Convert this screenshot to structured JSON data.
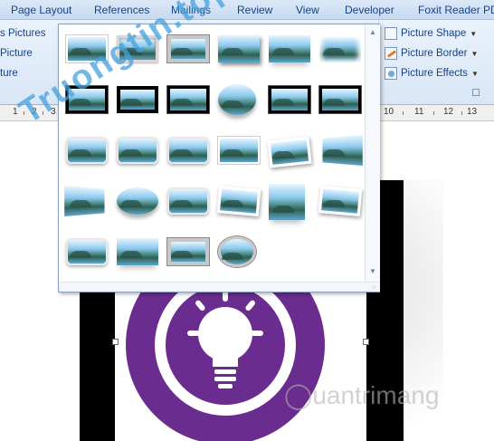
{
  "ribbon_tabs": [
    "Page Layout",
    "References",
    "Mailings",
    "Review",
    "View",
    "Developer",
    "Foxit Reader PDF"
  ],
  "left_group": {
    "item1": "s Pictures",
    "item2": "Picture",
    "item3": "ture"
  },
  "picture_tools": {
    "shape": "Picture Shape",
    "border": "Picture Border",
    "effects": "Picture Effects"
  },
  "ruler": {
    "left_marks": [
      "1",
      "2",
      "3"
    ],
    "right_marks": [
      "10",
      "11",
      "12",
      "13"
    ]
  },
  "gallery": {
    "styles": [
      "simple-frame-white",
      "beveled-matte-white",
      "metal-frame",
      "drop-shadow-rectangle",
      "reflected-rounded-rectangle",
      "soft-edge-rectangle",
      "double-frame-black",
      "thick-matte-black",
      "simple-frame-black",
      "beveled-oval-black",
      "compound-frame-black",
      "center-shadow-rectangle",
      "rounded-diagonal-corner-white",
      "snip-diagonal-corner-white",
      "moderate-frame-white",
      "rotated-white",
      "perspective-shadow-white",
      "relaxed-perspective-white",
      "soft-edge-oval",
      "bevel-rectangle",
      "bevel-perspective",
      "bevel-perspective-left",
      "reflected-bevel-black",
      "reflected-bevel-white",
      "metal-rounded-rectangle",
      "reflected-perspective-right",
      "metal-frame-white",
      "metal-oval"
    ]
  },
  "watermarks": {
    "logo": "Truongtin.top",
    "brand": "uantrimang"
  },
  "colors": {
    "ribbon_text": "#15428b",
    "tab_bar": "#dbe8f7",
    "document_frame": "#000000",
    "logo_purple": "#6a2c8e"
  }
}
